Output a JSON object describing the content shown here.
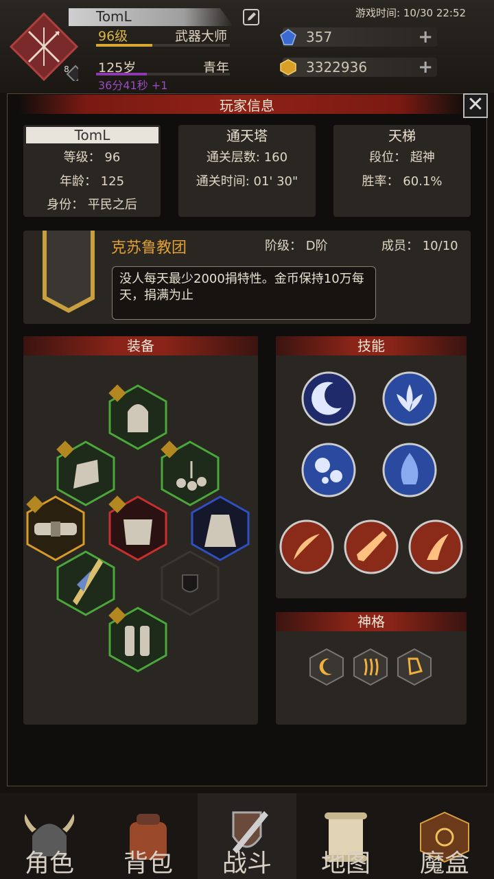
{
  "header": {
    "player_name": "TomL",
    "game_time": "游戏时间: 10/30 22:52",
    "level_text": "96级",
    "class_title": "武器大师",
    "level_progress": 0.42,
    "age_text": "125岁",
    "life_stage": "青年",
    "age_progress": 0.38,
    "timer_text": "36分41秒 +1",
    "avatar_badge": "8",
    "resources": [
      {
        "icon": "blue-gem-icon",
        "value": "357",
        "color": "#3a6bd0"
      },
      {
        "icon": "gold-ore-icon",
        "value": "3322936",
        "color": "#d8a028"
      }
    ]
  },
  "panel": {
    "title": "玩家信息",
    "close_symbol": "✕",
    "profile": {
      "name": "TomL",
      "level": "等级：  96",
      "age": "年龄：  125",
      "identity": "身份：  平民之后"
    },
    "tower": {
      "title": "通天塔",
      "floors": "通关层数: 160",
      "time": "通关时间: 01' 30\""
    },
    "ladder": {
      "title": "天梯",
      "rank": "段位：  超神",
      "winrate": "胜率：  60.1%"
    },
    "guild": {
      "name": "克苏鲁教团",
      "rank": "阶级：  D阶",
      "members": "成员：  10/10",
      "notice": "没人每天最少2000捐特性。金币保持10万每天，捐满为止"
    },
    "equipment_title": "装备",
    "skills_title": "技能",
    "divinity_title": "神格"
  },
  "nav": [
    {
      "label": "角色",
      "icon": "helmet-icon"
    },
    {
      "label": "背包",
      "icon": "backpack-icon"
    },
    {
      "label": "战斗",
      "icon": "sword-shield-icon"
    },
    {
      "label": "地图",
      "icon": "scroll-map-icon"
    },
    {
      "label": "魔盒",
      "icon": "magic-box-icon"
    }
  ]
}
